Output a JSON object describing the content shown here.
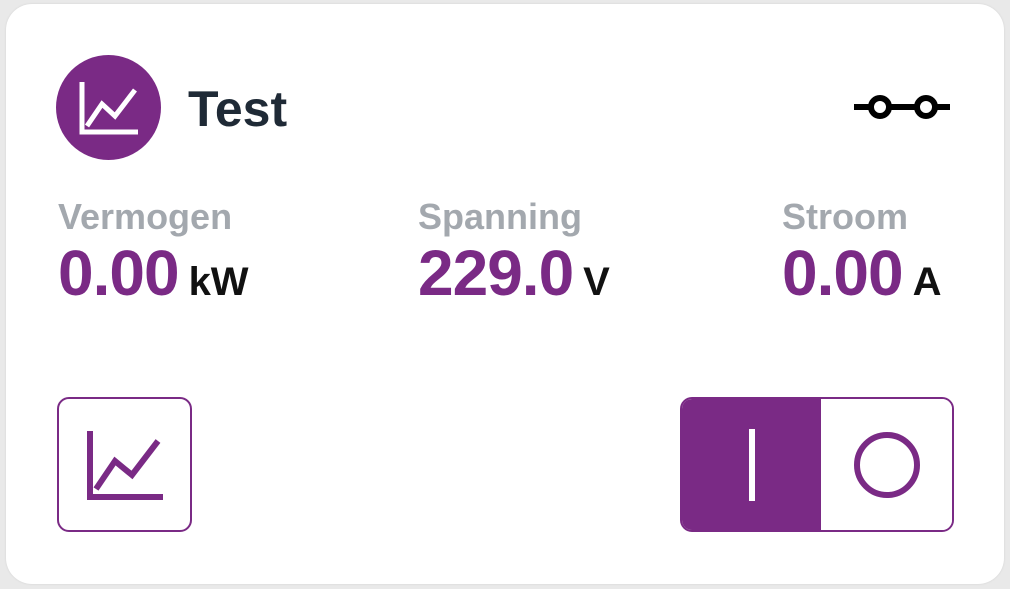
{
  "colors": {
    "accent": "#7a2a85",
    "title": "#1f2a36",
    "label": "#a3a8ae",
    "unit": "#111111"
  },
  "header": {
    "title": "Test",
    "avatar_icon": "chart-line-icon",
    "status_icon": "link-connection-icon"
  },
  "metrics": [
    {
      "label": "Vermogen",
      "value": "0.00",
      "unit": "kW"
    },
    {
      "label": "Spanning",
      "value": "229.0",
      "unit": "V"
    },
    {
      "label": "Stroom",
      "value": "0.00",
      "unit": "A"
    }
  ],
  "controls": {
    "chart_button_icon": "chart-line-icon",
    "power_toggle": {
      "state": "on",
      "on_icon": "power-on-icon",
      "off_icon": "power-off-icon"
    }
  }
}
